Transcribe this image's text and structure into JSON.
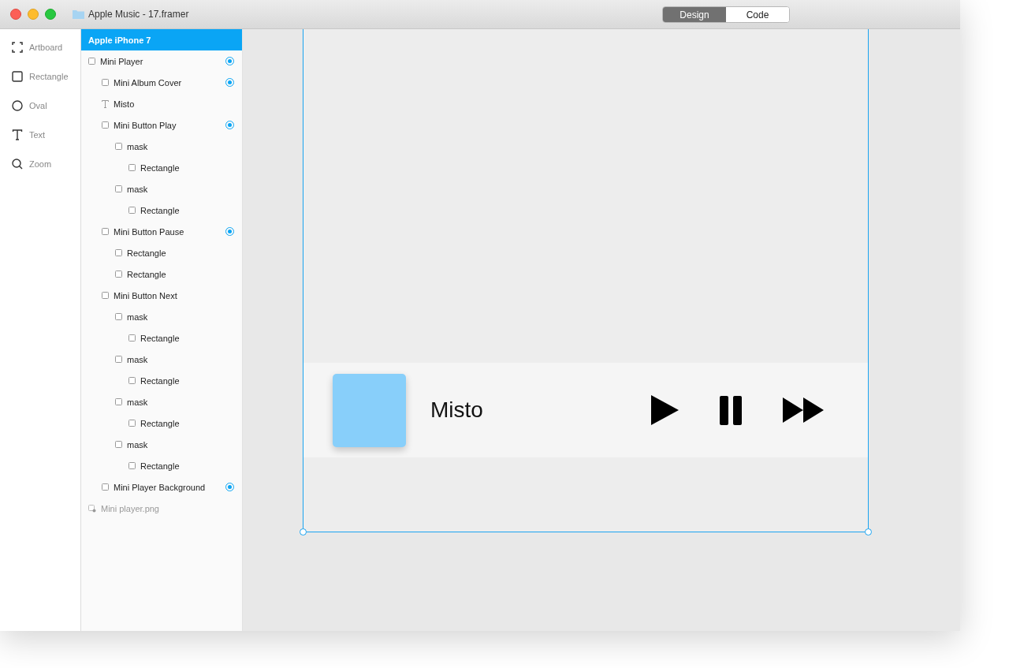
{
  "window": {
    "title": "Apple Music - 17.framer"
  },
  "mode_tabs": [
    {
      "label": "Design",
      "selected": true
    },
    {
      "label": "Code",
      "selected": false
    }
  ],
  "tools": [
    {
      "kind": "artboard",
      "label": "Artboard"
    },
    {
      "kind": "rectangle",
      "label": "Rectangle"
    },
    {
      "kind": "oval",
      "label": "Oval"
    },
    {
      "kind": "text",
      "label": "Text"
    },
    {
      "kind": "zoom",
      "label": "Zoom"
    }
  ],
  "layers": {
    "header": "Apple iPhone 7",
    "items": [
      {
        "kind": "layer",
        "label": "Mini Player",
        "targeted": true,
        "children": [
          {
            "kind": "layer",
            "label": "Mini Album Cover",
            "targeted": true
          },
          {
            "kind": "text",
            "label": "Misto",
            "targeted": false
          },
          {
            "kind": "layer",
            "label": "Mini Button Play",
            "targeted": true,
            "children": [
              {
                "kind": "layer",
                "label": "mask",
                "targeted": false,
                "children": [
                  {
                    "kind": "layer",
                    "label": "Rectangle",
                    "targeted": false
                  }
                ]
              },
              {
                "kind": "layer",
                "label": "mask",
                "targeted": false,
                "children": [
                  {
                    "kind": "layer",
                    "label": "Rectangle",
                    "targeted": false
                  }
                ]
              }
            ]
          },
          {
            "kind": "layer",
            "label": "Mini Button Pause",
            "targeted": true,
            "children": [
              {
                "kind": "layer",
                "label": "Rectangle",
                "targeted": false
              },
              {
                "kind": "layer",
                "label": "Rectangle",
                "targeted": false
              }
            ]
          },
          {
            "kind": "layer",
            "label": "Mini Button Next",
            "targeted": false,
            "children": [
              {
                "kind": "layer",
                "label": "mask",
                "targeted": false,
                "children": [
                  {
                    "kind": "layer",
                    "label": "Rectangle",
                    "targeted": false
                  }
                ]
              },
              {
                "kind": "layer",
                "label": "mask",
                "targeted": false,
                "children": [
                  {
                    "kind": "layer",
                    "label": "Rectangle",
                    "targeted": false
                  }
                ]
              },
              {
                "kind": "layer",
                "label": "mask",
                "targeted": false,
                "children": [
                  {
                    "kind": "layer",
                    "label": "Rectangle",
                    "targeted": false
                  }
                ]
              },
              {
                "kind": "layer",
                "label": "mask",
                "targeted": false,
                "children": [
                  {
                    "kind": "layer",
                    "label": "Rectangle",
                    "targeted": false
                  }
                ]
              }
            ]
          },
          {
            "kind": "layer",
            "label": "Mini Player Background",
            "targeted": true
          }
        ]
      },
      {
        "kind": "image",
        "label": "Mini player.png",
        "targeted": false
      }
    ]
  },
  "mini_player": {
    "title": "Misto",
    "controls": [
      {
        "kind": "play"
      },
      {
        "kind": "pause"
      },
      {
        "kind": "next"
      }
    ]
  }
}
